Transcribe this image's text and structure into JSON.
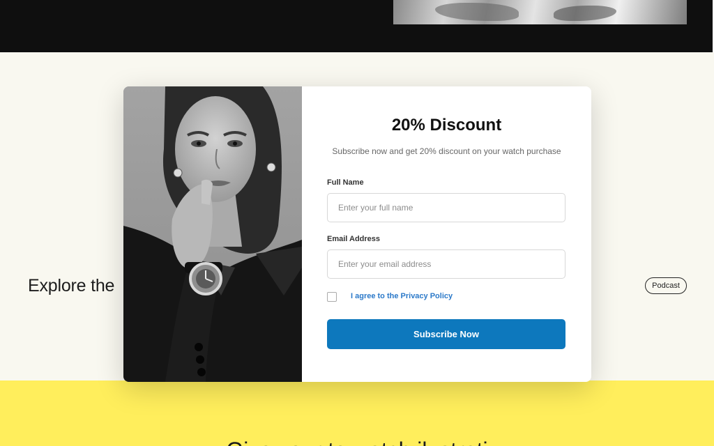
{
  "background": {
    "explore_text": "Explore the",
    "podcast_tag": "Podcast",
    "yellow_heading": "Give your to watch ilustrati"
  },
  "modal": {
    "title": "20% Discount",
    "subtitle": "Subscribe now and get 20% discount on your watch purchase",
    "close_label": "×",
    "full_name": {
      "label": "Full Name",
      "placeholder": "Enter your full name",
      "value": ""
    },
    "email": {
      "label": "Email Address",
      "placeholder": "Enter your email address",
      "value": ""
    },
    "privacy_label": "I agree to the Privacy Policy",
    "privacy_checked": false,
    "subscribe_label": "Subscribe Now",
    "colors": {
      "primary": "#0d78bd",
      "link": "#2b79c9",
      "page_bg": "#f9f8f0",
      "yellow": "#ffee5c",
      "dark": "#0f0f0f"
    }
  }
}
